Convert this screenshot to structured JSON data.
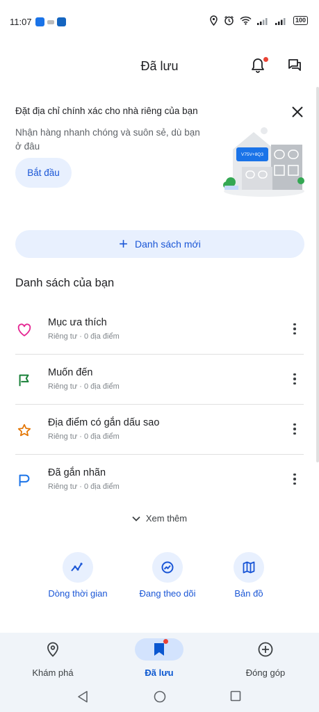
{
  "status_bar": {
    "time": "11:07",
    "battery": "100"
  },
  "header": {
    "title": "Đã lưu"
  },
  "promo": {
    "title": "Đặt địa chỉ chính xác cho nhà riêng của bạn",
    "description": "Nhận hàng nhanh chóng và suôn sẻ, dù bạn ở đâu",
    "button_label": "Bắt đầu",
    "plus_code": "V75V+8Q3"
  },
  "new_list_label": "Danh sách mới",
  "section_title": "Danh sách của bạn",
  "lists": [
    {
      "name": "Mục ưa thích",
      "meta": "Riêng tư · 0 địa điểm",
      "icon": "heart-icon",
      "color": "#e52592"
    },
    {
      "name": "Muốn đến",
      "meta": "Riêng tư · 0 địa điểm",
      "icon": "flag-icon",
      "color": "#188038"
    },
    {
      "name": "Địa điểm có gắn dấu sao",
      "meta": "Riêng tư · 0 địa điểm",
      "icon": "star-icon",
      "color": "#e37400"
    },
    {
      "name": "Đã gắn nhãn",
      "meta": "Riêng tư · 0 địa điểm",
      "icon": "label-flag-icon",
      "color": "#1a73e8"
    }
  ],
  "see_more_label": "Xem thêm",
  "shortcuts": [
    {
      "label": "Dòng thời gian",
      "icon": "timeline-icon"
    },
    {
      "label": "Đang theo dõi",
      "icon": "following-icon"
    },
    {
      "label": "Bản đồ",
      "icon": "map-icon"
    }
  ],
  "bottom_nav": [
    {
      "label": "Khám phá",
      "icon": "location-pin-icon",
      "active": false
    },
    {
      "label": "Đã lưu",
      "icon": "bookmark-icon",
      "active": true
    },
    {
      "label": "Đóng góp",
      "icon": "add-circle-icon",
      "active": false
    }
  ],
  "colors": {
    "accent": "#1a56d6",
    "accent_bg": "#e8f0fe",
    "notification_dot": "#ea4335"
  }
}
